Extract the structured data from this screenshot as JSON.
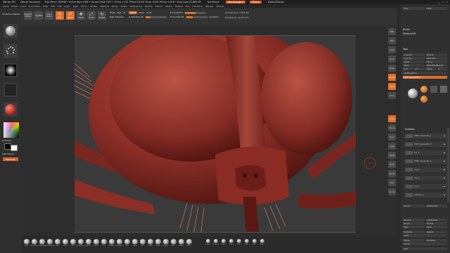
{
  "titlebar": {
    "app": "ZBrush 4R7",
    "doc": "ZBrush Document",
    "info": "Free Mem 1.993GB • Active Mem 1996 • Scratch Disk 2097 • ZTime 1.431 PTime 28.204 Timer 0.001 PTimer 0.019 • PolyCount 23.869 MP",
    "quicksave": "QuickSave",
    "see_through": "See-through 0",
    "menus": "Menus",
    "script": "DefaultZScript"
  },
  "menus": [
    "Alpha",
    "Brush",
    "Color",
    "Document",
    "Draw",
    "Edit",
    "File",
    "Layer",
    "Light",
    "Macro",
    "Marker",
    "Material",
    "Movie",
    "Picker",
    "Preferences",
    "Render",
    "Stencil",
    "Stroke",
    "Texture",
    "Tool",
    "Transform",
    "ZPlugin",
    "ZScript"
  ],
  "toolbar": {
    "projection_label": "Projection Master",
    "lightbox_label": "LightBox",
    "quicksketch_label": "Quick Sketch",
    "edit_label": "Edit",
    "draw_label": "Draw",
    "move_label": "Move",
    "scale_label": "Scale",
    "rotate_label": "Rotate",
    "mrgb_label": "Mrgb",
    "rgb_label": "Rgb",
    "m_label": "M",
    "zadd_label": "Zadd",
    "zsub_label": "Zsub",
    "zcut_label": "Zcut",
    "rgb_intensity_label": "Rgb Intensity",
    "z_intensity_label": "Z Intensity 25",
    "focal_shift_label": "Focal Shift 0",
    "draw_size_label": "Draw Size 64",
    "dynamic_label": "Dynamic",
    "active_points_label": "ActivePoints: 1.856 Mil",
    "total_points_label": "TotalPoints: 10.011 Mil",
    "z_intensity_fill": 0.25,
    "focal_shift_fill": 0.5,
    "draw_size_fill": 0.3
  },
  "leftbar": {
    "title": "Projection Master",
    "gradient_label": "Gradient",
    "switch_color_label": "SwitchColor",
    "alternate_label": "Alternate"
  },
  "rightpanel": {
    "copy_label": "Copy",
    "paste_label": "Paste",
    "brush_header": "Brush",
    "texture_header": "TextureOff",
    "tool_header": "Tool",
    "load_tool": "Load Tool",
    "save_as": "Save As",
    "copy_tool": "Copy Tool",
    "paste_tool": "Paste Tool",
    "import": "Import",
    "export": "Export",
    "clone": "Clone",
    "make_polymesh": "Make PolyMesh3D",
    "goz": "GoZ",
    "all": "All",
    "visible": "Visible",
    "r": "R",
    "lightbox_tools": "Lightbox▸Tools",
    "tool_name": "PM3D_Sphere3D_1",
    "subtool_header": "SubTool",
    "subtools": [
      "PM3D_Sphere3D_1",
      "PM3D_Sphere3D_3",
      "Tail_1",
      "PM3D_Sphere3D_5",
      "Leg_1",
      "Leg_2",
      "Leg_3",
      "Antenna_1"
    ],
    "list_all": "List All",
    "rename": "Rename",
    "autoreorder": "AutoReorder",
    "all_low": "All Low",
    "all_high": "All High",
    "copy": "Copy",
    "paste": "Paste",
    "duplicate": "Duplicate",
    "append": "Append",
    "insert": "Insert",
    "delete": "Delete",
    "del_other": "Del Other",
    "del_all": "Del All",
    "split": "Split"
  },
  "rnav": [
    "BPR",
    "SPix",
    "Scroll",
    "Zoom",
    "Actual",
    "AAHalf",
    "Persp",
    "Floor",
    "Local",
    "Frame",
    "Move",
    "Scale",
    "Rotate",
    "PolyF",
    "Transp",
    "Solo",
    "Xpose"
  ],
  "shelf": {
    "brushes": [
      "Move",
      "Standard",
      "ClayBuildup",
      "DamStandard",
      "Inflat",
      "Pinch",
      "Polish",
      "TrimDynamic",
      "hPolish",
      "Slash3",
      "Clay",
      "ClayTubes",
      "SnakeHook",
      "Dam",
      "Flatten",
      "Layer",
      "Nudge",
      "Planar",
      "Magnify",
      "Rake",
      "Smooth",
      "Elastic"
    ],
    "tools": [
      "Imbed",
      "Elevation",
      "Mask",
      "Blob",
      "Bend",
      "Twist",
      "Taper",
      "Spiral"
    ]
  },
  "colors": {
    "accent": "#e0702c",
    "model": "#a03a30",
    "model_dark": "#6b1f1a",
    "canvas_bg": "#3a3a3a"
  }
}
